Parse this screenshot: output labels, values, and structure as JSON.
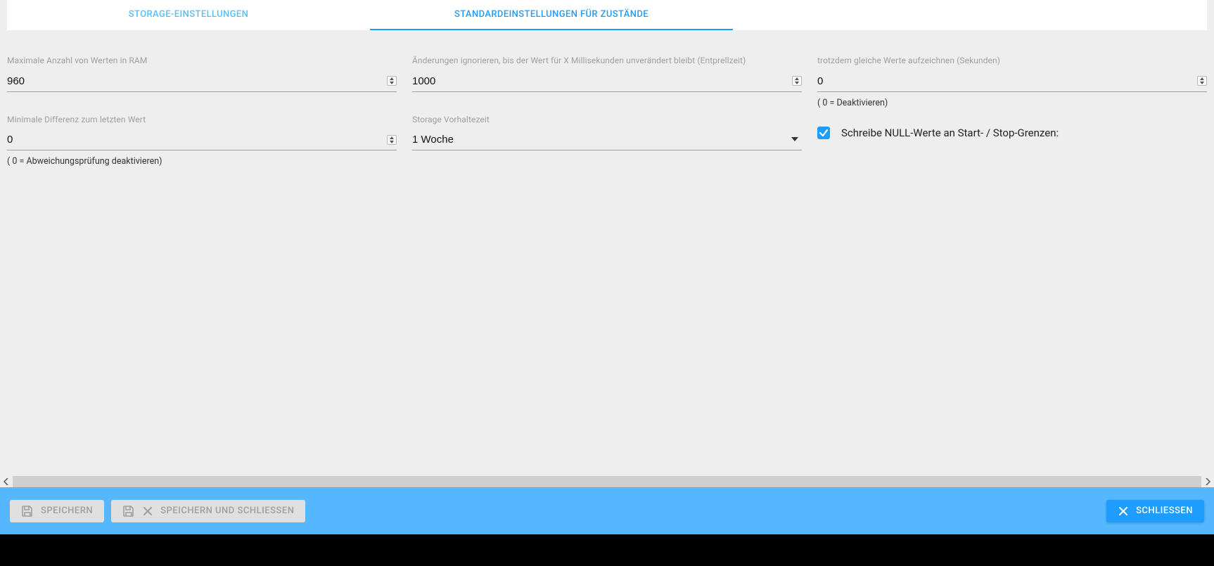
{
  "tabs": {
    "storage": "STORAGE-EINSTELLUNGEN",
    "defaults": "STANDARDEINSTELLUNGEN FÜR ZUSTÄNDE"
  },
  "fields": {
    "maxRam": {
      "label": "Maximale Anzahl von Werten in RAM",
      "value": "960"
    },
    "debounce": {
      "label": "Änderungen ignorieren, bis der Wert für X Millisekunden unverändert bleibt (Entprellzeit)",
      "value": "1000"
    },
    "recordSame": {
      "label": "trotzdem gleiche Werte aufzeichnen (Sekunden)",
      "value": "0",
      "helper": "( 0 = Deaktivieren)"
    },
    "minDiff": {
      "label": "Minimale Differenz zum letzten Wert",
      "value": "0",
      "helper": "( 0 = Abweichungsprüfung deaktivieren)"
    },
    "retention": {
      "label": "Storage Vorhaltezeit",
      "value": "1 Woche"
    },
    "writeNull": {
      "label": "Schreibe NULL-Werte an Start- / Stop-Grenzen:",
      "checked": true
    }
  },
  "footer": {
    "save": "SPEICHERN",
    "saveClose": "SPEICHERN UND SCHLIESSEN",
    "close": "SCHLIESSEN"
  }
}
